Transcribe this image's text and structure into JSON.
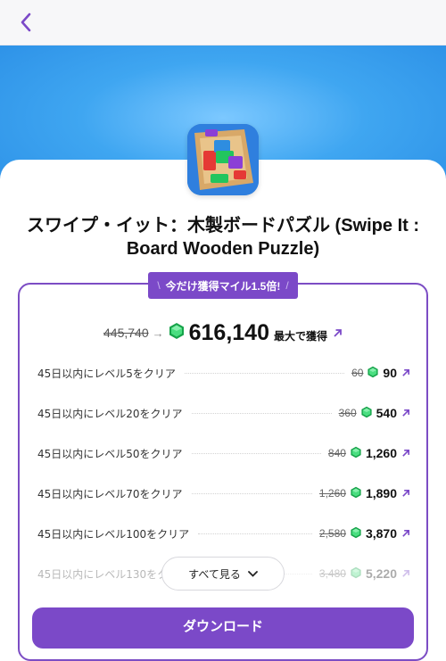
{
  "nav": {
    "back_icon": "chevron-left-icon"
  },
  "app": {
    "title": "スワイプ・イット：木製ボードパズル (Swipe It : Board Wooden Puzzle)",
    "icon": "block-puzzle-app-icon"
  },
  "promo": {
    "left_mark": "\\",
    "text": "今だけ獲得マイル1.5倍!",
    "right_mark": "/"
  },
  "summary": {
    "old_total": "445,740",
    "arrow": "→",
    "new_total": "616,140",
    "label": "最大で獲得"
  },
  "rewards": [
    {
      "label": "45日以内にレベル5をクリア",
      "old": "60",
      "new": "90"
    },
    {
      "label": "45日以内にレベル20をクリア",
      "old": "360",
      "new": "540"
    },
    {
      "label": "45日以内にレベル50をクリア",
      "old": "840",
      "new": "1,260"
    },
    {
      "label": "45日以内にレベル70をクリア",
      "old": "1,260",
      "new": "1,890"
    },
    {
      "label": "45日以内にレベル100をクリア",
      "old": "2,580",
      "new": "3,870"
    },
    {
      "label": "45日以内にレベル130をクリア",
      "old": "3,480",
      "new": "5,220"
    }
  ],
  "see_all": "すべて見る",
  "download": "ダウンロード",
  "colors": {
    "accent": "#7b49c8",
    "gem": "#22c55e",
    "hero": "#3fa6f1"
  }
}
